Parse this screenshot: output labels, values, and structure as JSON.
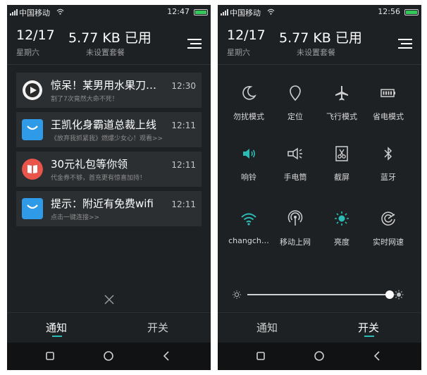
{
  "status": {
    "carrier": "中国移动",
    "time_left": "12:47",
    "time_right": "12:56"
  },
  "header": {
    "date": "12/17",
    "weekday": "星期六",
    "usage": "5.77 KB 已用",
    "plan": "未设置套餐"
  },
  "notifications": [
    {
      "title": "惊呆！某男用水果刀…",
      "subtitle": "割了7次竟然大命不死！",
      "time": "12:30",
      "icon": "play-icon"
    },
    {
      "title": "王凯化身霸道总裁上线",
      "subtitle": "《放弃我抓紧我》燃爆少女心！观看>>",
      "time": "12:11",
      "icon": "shopping-bag-icon"
    },
    {
      "title": "30元礼包等你领",
      "subtitle": "代金券不够，首充更有惊喜加持！",
      "time": "12:11",
      "icon": "book-icon"
    },
    {
      "title": "提示：附近有免费wifi",
      "subtitle": "点击一键连接>>",
      "time": "12:11",
      "icon": "shopping-bag-icon"
    }
  ],
  "tabs": {
    "notify": "通知",
    "toggles": "开关"
  },
  "toggles": [
    {
      "label": "勿扰模式",
      "icon": "moon-icon",
      "active": false
    },
    {
      "label": "定位",
      "icon": "location-icon",
      "active": false
    },
    {
      "label": "飞行模式",
      "icon": "airplane-icon",
      "active": false
    },
    {
      "label": "省电模式",
      "icon": "battery-saver-icon",
      "active": false
    },
    {
      "label": "响铃",
      "icon": "speaker-icon",
      "active": true
    },
    {
      "label": "手电筒",
      "icon": "flashlight-icon",
      "active": false
    },
    {
      "label": "截屏",
      "icon": "screenshot-icon",
      "active": false
    },
    {
      "label": "蓝牙",
      "icon": "bluetooth-icon",
      "active": false
    },
    {
      "label": "changch…",
      "icon": "wifi-icon",
      "active": true
    },
    {
      "label": "移动上网",
      "icon": "mobile-data-icon",
      "active": false
    },
    {
      "label": "亮度",
      "icon": "sun-icon",
      "active": true
    },
    {
      "label": "实时网速",
      "icon": "network-speed-icon",
      "active": false
    }
  ],
  "brightness": {
    "level": 1.0
  },
  "colors": {
    "accent": "#2bbcb5",
    "panel": "#1e2124",
    "card": "#2c2f32"
  }
}
